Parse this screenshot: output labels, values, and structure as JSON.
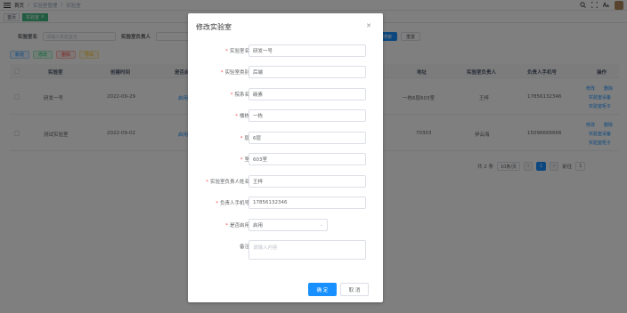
{
  "topbar": {
    "breadcrumb": [
      "首页",
      "实验室管理",
      "实验室"
    ]
  },
  "tags": [
    "首页",
    "实验室"
  ],
  "search": {
    "field1_label": "实验室名",
    "field1_placeholder": "请输入实验室名",
    "field2_label": "实验室负责人",
    "search_btn": "搜索",
    "reset_btn": "重置"
  },
  "toolbar": {
    "add": "新增",
    "edit": "修改",
    "delete": "删除",
    "export": "导出"
  },
  "table": {
    "headers": [
      "实验室",
      "创建时间",
      "是否启用",
      "地址",
      "实验室负责人",
      "负责人手机号",
      "操作"
    ],
    "rows": [
      {
        "name": "研发一号",
        "date": "2022-09-29",
        "status": "启用",
        "address": "一栋6层603室",
        "owner": "王梓",
        "phone": "17856132346",
        "op1": "修改",
        "op2": "删除",
        "op3": "实验室设备",
        "op4": "实验室柜子"
      },
      {
        "name": "测试实验室",
        "date": "2022-09-02",
        "status": "启用",
        "address": "70303",
        "owner": "伊云海",
        "phone": "15096666666",
        "op1": "修改",
        "op2": "删除",
        "op3": "实验室设备",
        "op4": "实验室柜子"
      }
    ]
  },
  "pagination": {
    "total": "共 2 条",
    "page_size": "10条/页",
    "current": "1",
    "goto_label": "前往",
    "goto_value": "1"
  },
  "dialog": {
    "title": "修改实验室",
    "fields": [
      {
        "label": "实验室名",
        "required": "*",
        "value": "研发一号"
      },
      {
        "label": "实验室类别",
        "required": "*",
        "value": "后端"
      },
      {
        "label": "院系名",
        "required": "*",
        "value": "碳素"
      },
      {
        "label": "楼栋",
        "required": "*",
        "value": "一栋"
      },
      {
        "label": "层",
        "required": "*",
        "value": "6层"
      },
      {
        "label": "室",
        "required": "*",
        "value": "603室"
      },
      {
        "label": "实验室负责人姓名",
        "required": "*",
        "value": "王梓"
      },
      {
        "label": "负责人手机号",
        "required": "*",
        "value": "17856132346"
      },
      {
        "label": "是否启用",
        "required": "*",
        "value": "启用"
      },
      {
        "label": "备注",
        "required": "",
        "placeholder": "请输入内容"
      }
    ],
    "ok": "确 定",
    "cancel": "取 消"
  },
  "colors": {
    "primary": "#1890ff",
    "required": "#ff4949",
    "mask": "rgba(0,0,0,0.5)"
  }
}
